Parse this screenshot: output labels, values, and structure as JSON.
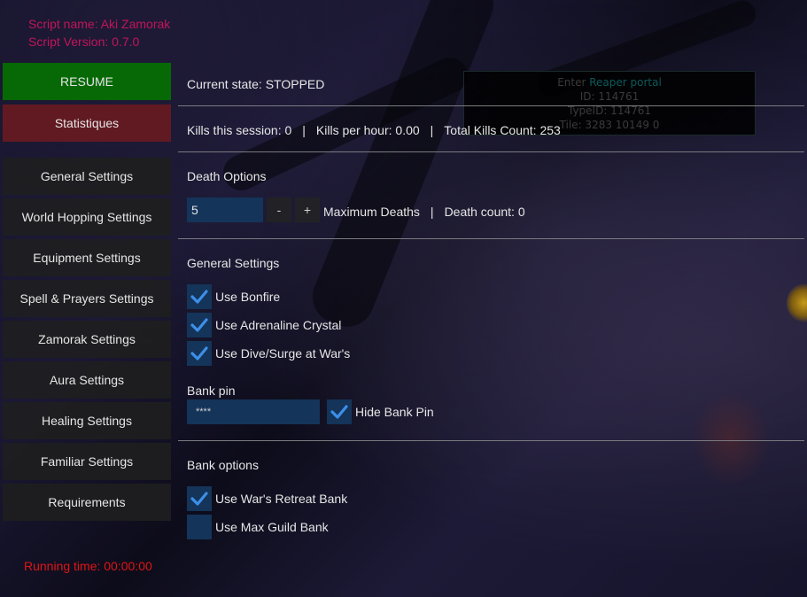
{
  "script": {
    "name_line": "Script name: Aki Zamorak",
    "version_line": "Script Version: 0.7.0"
  },
  "colors": {
    "resume": "#066906",
    "statistics": "#621a22",
    "script_info": "#c0155a",
    "running_time": "#e01515",
    "input_bg": "#143459",
    "check": "#3d8fe8"
  },
  "sidebar": {
    "resume_label": "RESUME",
    "statistics_label": "Statistiques",
    "items": [
      {
        "label": "General Settings"
      },
      {
        "label": "World Hopping Settings"
      },
      {
        "label": "Equipment Settings"
      },
      {
        "label": "Spell & Prayers Settings"
      },
      {
        "label": "Zamorak Settings"
      },
      {
        "label": "Aura Settings"
      },
      {
        "label": "Healing Settings"
      },
      {
        "label": "Familiar Settings"
      },
      {
        "label": "Requirements"
      }
    ],
    "running_time": "Running time: 00:00:00"
  },
  "main": {
    "current_state": "Current state: STOPPED",
    "stats": {
      "kills_session": "Kills this session: 0",
      "kills_hour": "Kills per hour: 0.00",
      "total_kills": "Total Kills Count: 253",
      "separator": "|"
    },
    "death_options": {
      "title": "Death Options",
      "max_deaths_value": "5",
      "minus_label": "-",
      "plus_label": "+",
      "max_deaths_label": "Maximum Deaths",
      "separator": "|",
      "death_count": "Death count: 0"
    },
    "general_settings": {
      "title": "General Settings",
      "checkboxes": [
        {
          "label": "Use Bonfire",
          "checked": true
        },
        {
          "label": "Use Adrenaline Crystal",
          "checked": true
        },
        {
          "label": "Use Dive/Surge at War's",
          "checked": true
        }
      ],
      "bank_pin_label": "Bank pin",
      "bank_pin_value": "****",
      "hide_bank_pin": {
        "label": "Hide Bank Pin",
        "checked": true
      }
    },
    "bank_options": {
      "title": "Bank options",
      "checkboxes": [
        {
          "label": "Use War's Retreat Bank",
          "checked": true
        },
        {
          "label": "Use Max Guild Bank",
          "checked": false
        }
      ]
    }
  },
  "game_tooltip": {
    "action": "Enter",
    "target": "Reaper portal",
    "id_line": "ID: 114761",
    "type_id_line": "TypeID: 114761",
    "tile_line": "Tile: 3283 10149 0"
  }
}
